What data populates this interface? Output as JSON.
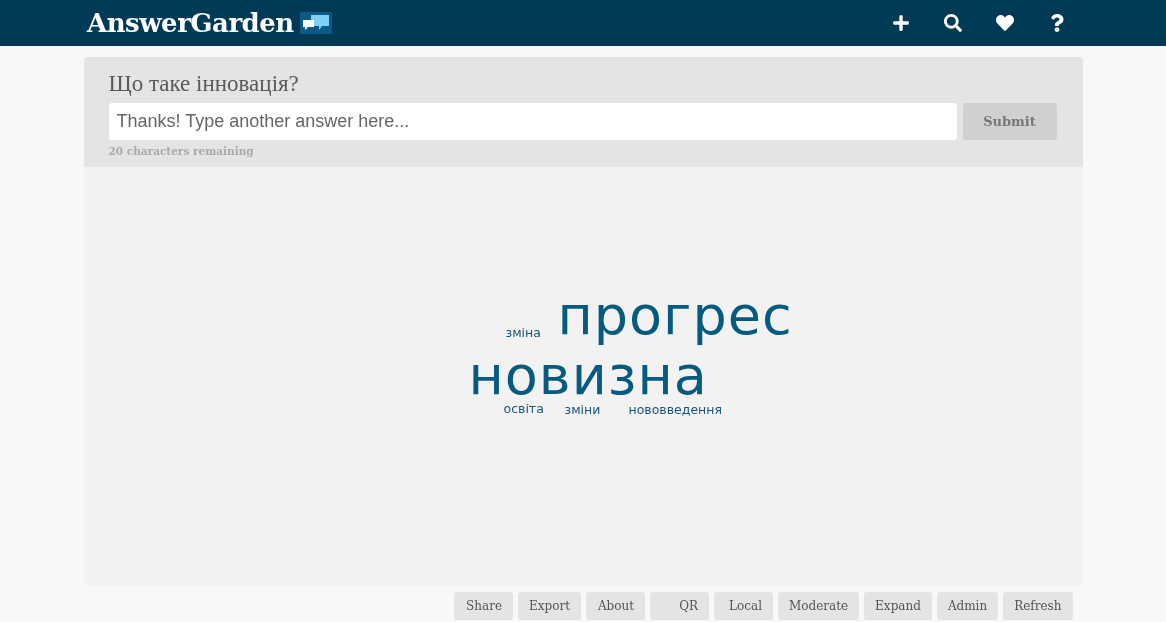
{
  "header": {
    "logo": "AnswerGarden"
  },
  "question": {
    "title": "Що таке інновація?",
    "input": {
      "placeholder": "Thanks! Type another answer here..."
    },
    "submit": "Submit",
    "remaining": "20 characters remaining"
  },
  "answers": [
    {
      "text": "зміна",
      "kind": "small"
    },
    {
      "text": "прогрес",
      "kind": "large"
    },
    {
      "text": "новизна",
      "kind": "large"
    },
    {
      "text": "освіта",
      "kind": "small"
    },
    {
      "text": "зміни",
      "kind": "small"
    },
    {
      "text": "нововведення",
      "kind": "small"
    }
  ],
  "buttons": [
    "Share",
    "Export",
    "About",
    "QR",
    "Local",
    "Moderate",
    "Expand",
    "Admin",
    "Refresh"
  ]
}
